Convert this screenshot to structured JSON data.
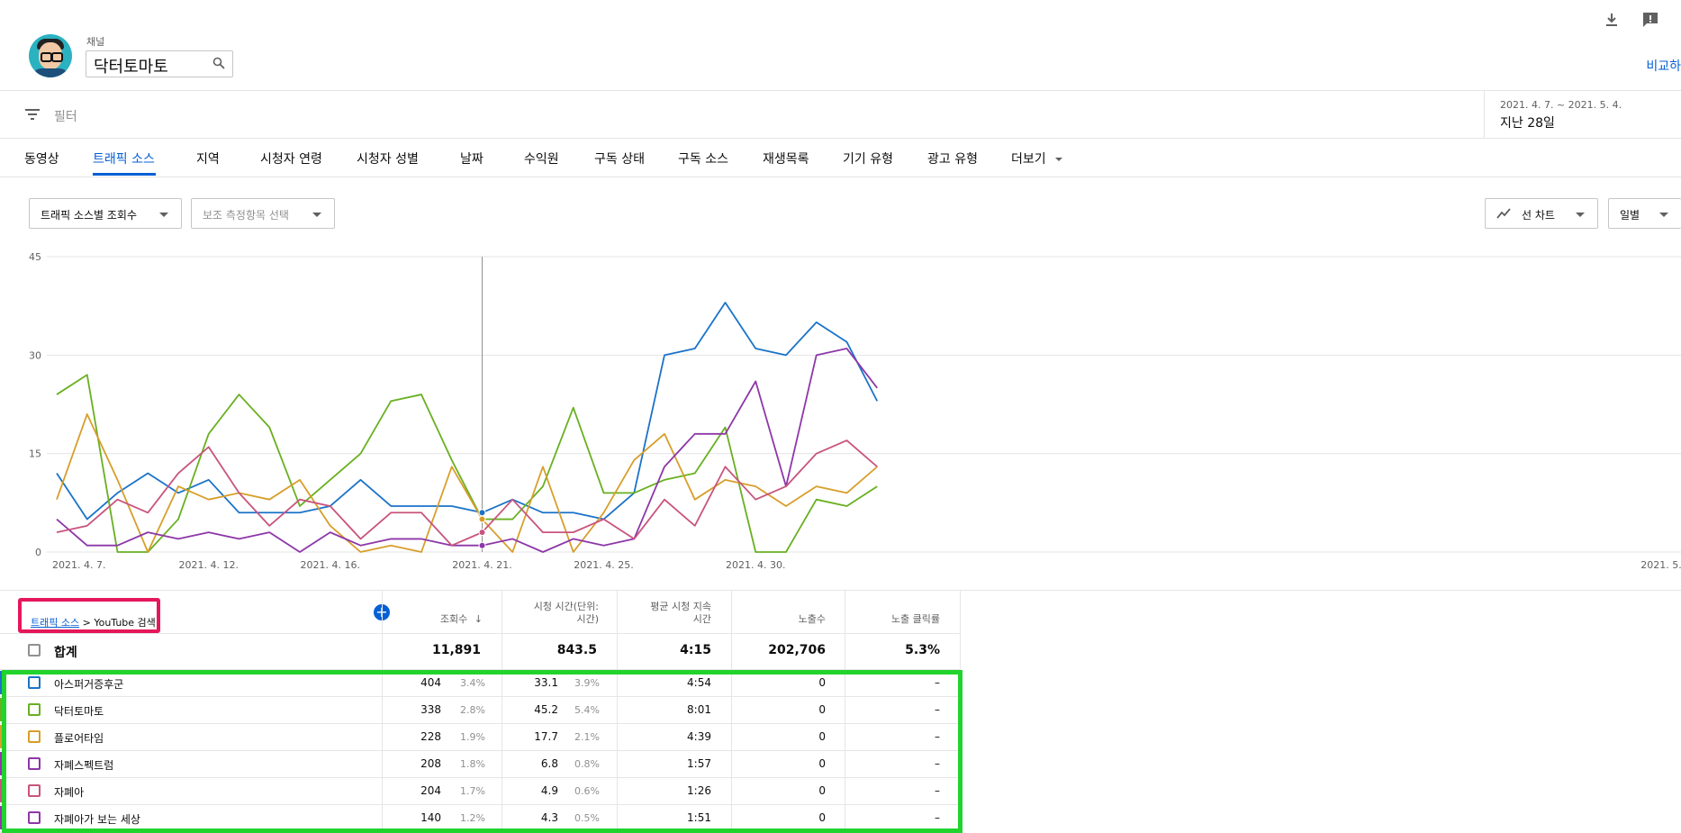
{
  "header": {
    "channel_label": "채널",
    "channel_name": "닥터토마토",
    "compare_label": "비교하"
  },
  "filter": {
    "placeholder": "필터"
  },
  "date": {
    "range": "2021. 4. 7. ~ 2021. 5. 4.",
    "label": "지난 28일"
  },
  "tabs": [
    "동영상",
    "트래픽 소스",
    "지역",
    "시청자 연령",
    "시청자 성별",
    "날짜",
    "수익원",
    "구독 상태",
    "구독 소스",
    "재생목록",
    "기기 유형",
    "광고 유형",
    "더보기"
  ],
  "active_tab": "트래픽 소스",
  "controls": {
    "metric": "트래픽 소스별 조회수",
    "secondary": "보조 측정항목 선택",
    "chart_type": "선 차트",
    "granularity": "일별"
  },
  "chart_data": {
    "type": "line",
    "x": [
      "2021. 4. 7.",
      "2021. 4. 8.",
      "2021. 4. 9.",
      "2021. 4. 10.",
      "2021. 4. 11.",
      "2021. 4. 12.",
      "2021. 4. 13.",
      "2021. 4. 14.",
      "2021. 4. 15.",
      "2021. 4. 16.",
      "2021. 4. 17.",
      "2021. 4. 18.",
      "2021. 4. 19.",
      "2021. 4. 20.",
      "2021. 4. 21.",
      "2021. 4. 22.",
      "2021. 4. 23.",
      "2021. 4. 24.",
      "2021. 4. 25.",
      "2021. 4. 26.",
      "2021. 4. 27.",
      "2021. 4. 28.",
      "2021. 4. 29.",
      "2021. 4. 30.",
      "2021. 5. 1.",
      "2021. 5. 2.",
      "2021. 5. 3.",
      "2021. 5. 4."
    ],
    "xticks": [
      "2021. 4. 7.",
      "2021. 4. 12.",
      "2021. 4. 16.",
      "2021. 4. 21.",
      "2021. 4. 25.",
      "2021. 4. 30.",
      "2021. 5."
    ],
    "yticks": [
      "0",
      "15",
      "30",
      "45"
    ],
    "ylim": [
      0,
      45
    ],
    "hover_x": "2021. 4. 21.",
    "series": [
      {
        "name": "아스퍼거증후군",
        "color": "#1a73c8",
        "values": [
          12,
          5,
          9,
          12,
          9,
          11,
          6,
          6,
          6,
          7,
          11,
          7,
          7,
          7,
          6,
          8,
          6,
          6,
          5,
          9,
          30,
          31,
          38,
          31,
          30,
          35,
          32,
          23
        ]
      },
      {
        "name": "닥터토마토",
        "color": "#68b020",
        "values": [
          24,
          27,
          0,
          0,
          5,
          18,
          24,
          19,
          7,
          11,
          15,
          23,
          24,
          14,
          5,
          5,
          10,
          22,
          9,
          9,
          11,
          12,
          19,
          0,
          0,
          8,
          7,
          10
        ]
      },
      {
        "name": "플로어타임",
        "color": "#d79e2a",
        "values": [
          8,
          21,
          11,
          0,
          10,
          8,
          9,
          8,
          11,
          4,
          0,
          1,
          0,
          13,
          5,
          0,
          13,
          0,
          6,
          14,
          18,
          8,
          11,
          10,
          7,
          10,
          9,
          13
        ]
      },
      {
        "name": "자폐스펙트럼",
        "color": "#8d37a8",
        "values": [
          5,
          1,
          1,
          3,
          2,
          3,
          2,
          3,
          0,
          3,
          1,
          2,
          2,
          1,
          1,
          2,
          0,
          2,
          1,
          2,
          13,
          18,
          18,
          26,
          10,
          30,
          31,
          25
        ]
      },
      {
        "name": "자폐아",
        "color": "#c8547e",
        "values": [
          3,
          4,
          8,
          6,
          12,
          16,
          9,
          4,
          8,
          7,
          2,
          6,
          6,
          1,
          3,
          8,
          3,
          3,
          5,
          2,
          8,
          4,
          13,
          8,
          10,
          15,
          17,
          13
        ]
      }
    ]
  },
  "table": {
    "breadcrumb_link": "트래픽 소스",
    "breadcrumb_sep": " > ",
    "breadcrumb_current": "YouTube 검색",
    "add_column": "+",
    "headers": {
      "views": "조회수",
      "watch_time": [
        "시청 시간(단위:",
        "시간)"
      ],
      "avg_duration": [
        "평균 시청 지속",
        "시간"
      ],
      "impressions": "노출수",
      "ctr": "노출 클릭률"
    },
    "total": {
      "label": "합계",
      "views": "11,891",
      "watch": "843.5",
      "avg": "4:15",
      "impressions": "202,706",
      "ctr": "5.3%"
    },
    "rows": [
      {
        "name": "아스퍼거증후군",
        "views": "404",
        "views_pct": "3.4%",
        "watch": "33.1",
        "watch_pct": "3.9%",
        "avg": "4:54",
        "impressions": "0",
        "ctr": "–",
        "color": "#1a73c8"
      },
      {
        "name": "닥터토마토",
        "views": "338",
        "views_pct": "2.8%",
        "watch": "45.2",
        "watch_pct": "5.4%",
        "avg": "8:01",
        "impressions": "0",
        "ctr": "–",
        "color": "#68b020"
      },
      {
        "name": "플로어타임",
        "views": "228",
        "views_pct": "1.9%",
        "watch": "17.7",
        "watch_pct": "2.1%",
        "avg": "4:39",
        "impressions": "0",
        "ctr": "–",
        "color": "#d79e2a"
      },
      {
        "name": "자폐스펙트럼",
        "views": "208",
        "views_pct": "1.8%",
        "watch": "6.8",
        "watch_pct": "0.8%",
        "avg": "1:57",
        "impressions": "0",
        "ctr": "–",
        "color": "#8d37a8"
      },
      {
        "name": "자폐아",
        "views": "204",
        "views_pct": "1.7%",
        "watch": "4.9",
        "watch_pct": "0.6%",
        "avg": "1:26",
        "impressions": "0",
        "ctr": "–",
        "color": "#c8547e"
      },
      {
        "name": "자폐아가 보는 세상",
        "views": "140",
        "views_pct": "1.2%",
        "watch": "4.3",
        "watch_pct": "0.5%",
        "avg": "1:51",
        "impressions": "0",
        "ctr": "–",
        "color": "#8d37a8"
      }
    ]
  }
}
